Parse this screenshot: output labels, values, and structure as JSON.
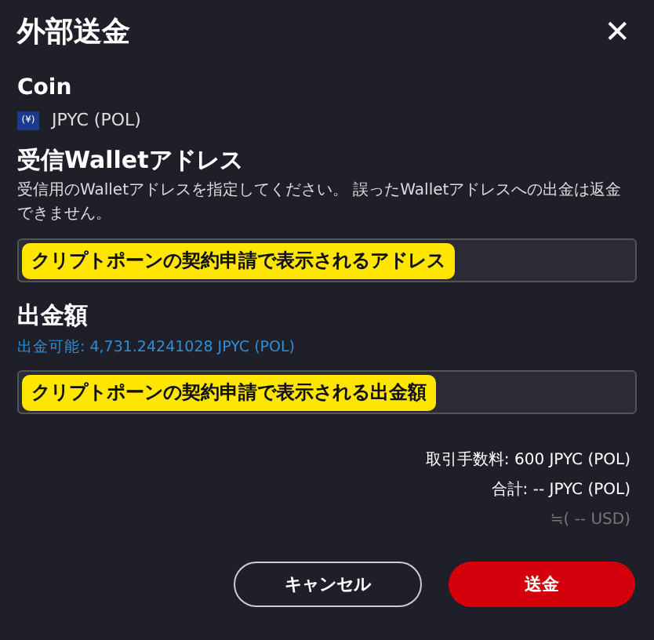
{
  "dialog": {
    "title": "外部送金",
    "close": "✕"
  },
  "coin": {
    "label": "Coin",
    "icon_text": "(¥)",
    "name": "JPYC (POL)"
  },
  "address": {
    "label": "受信Walletアドレス",
    "description": "受信用のWalletアドレスを指定してください。 誤ったWalletアドレスへの出金は返金できません。",
    "value": "クリプトポーンの契約申請で表示されるアドレス"
  },
  "amount": {
    "label": "出金額",
    "available": "出金可能: 4,731.24241028 JPYC (POL)",
    "value": "クリプトポーンの契約申請で表示される出金額"
  },
  "summary": {
    "fee": "取引手数料: 600 JPYC (POL)",
    "total": "合計: -- JPYC (POL)",
    "usd": "≒( -- USD)"
  },
  "buttons": [
    {
      "label": "キャンセル",
      "kind": "secondary"
    },
    {
      "label": "送金",
      "kind": "primary"
    }
  ]
}
